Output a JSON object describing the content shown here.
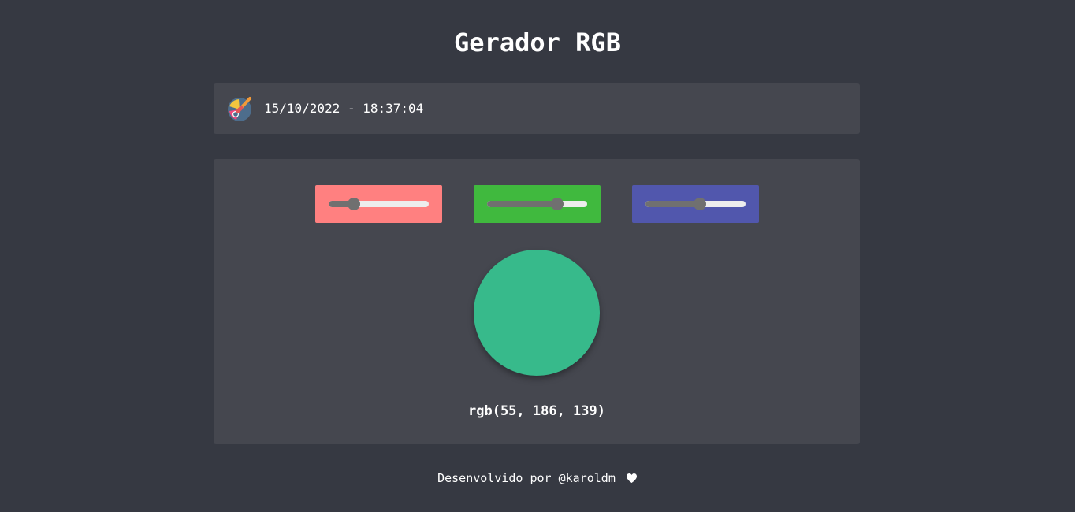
{
  "header": {
    "title": "Gerador RGB"
  },
  "datebar": {
    "icon": "palette-icon",
    "datetime": "15/10/2022 - 18:37:04"
  },
  "sliders": [
    {
      "channel": "red",
      "value": 55,
      "min": 0,
      "max": 255,
      "box_color": "#ff8080"
    },
    {
      "channel": "green",
      "value": 186,
      "min": 0,
      "max": 255,
      "box_color": "#40b93e"
    },
    {
      "channel": "blue",
      "value": 139,
      "min": 0,
      "max": 255,
      "box_color": "#5157ad"
    }
  ],
  "swatch": {
    "color": "#37ba8b"
  },
  "rgb_label": "rgb(55, 186, 139)",
  "footer": {
    "text": "Desenvolvido por @karoldm",
    "icon": "heart-icon"
  }
}
